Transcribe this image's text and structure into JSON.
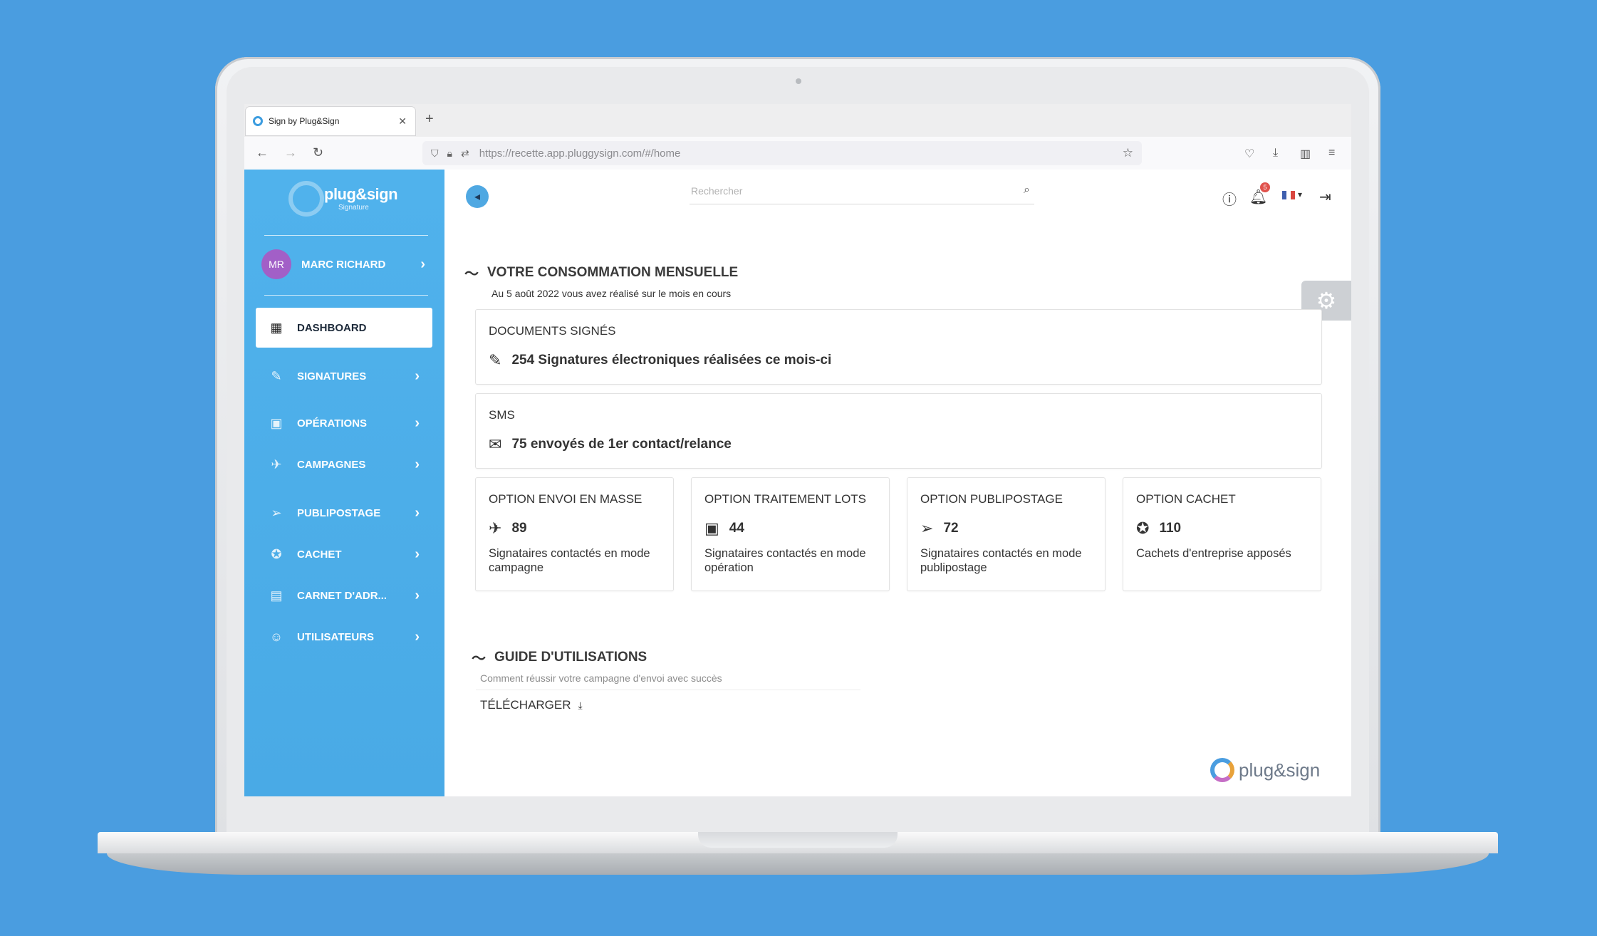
{
  "browser": {
    "tab_title": "Sign by Plug&Sign",
    "url": "https://recette.app.pluggysign.com/#/home"
  },
  "sidebar": {
    "logo_text": "plug&sign",
    "logo_sub": "Signature",
    "user": {
      "initials": "MR",
      "name": "MARC RICHARD"
    },
    "items": [
      {
        "label": "DASHBOARD",
        "icon": "dashboard-icon",
        "active": true
      },
      {
        "label": "SIGNATURES",
        "icon": "signature-icon"
      },
      {
        "label": "OPÉRATIONS",
        "icon": "operations-icon"
      },
      {
        "label": "CAMPAGNES",
        "icon": "campaign-icon"
      },
      {
        "label": "PUBLIPOSTAGE",
        "icon": "send-icon"
      },
      {
        "label": "CACHET",
        "icon": "stamp-icon"
      },
      {
        "label": "CARNET D'ADR...",
        "icon": "address-book-icon"
      },
      {
        "label": "UTILISATEURS",
        "icon": "users-icon"
      }
    ]
  },
  "header": {
    "search_placeholder": "Rechercher",
    "notification_count": "5"
  },
  "consumption": {
    "title": "VOTRE CONSOMMATION MENSUELLE",
    "subtitle": "Au 5 août 2022 vous avez réalisé sur le mois en cours",
    "documents": {
      "title": "DOCUMENTS SIGNÉS",
      "value": "254 Signatures électroniques réalisées ce mois-ci"
    },
    "sms": {
      "title": "SMS",
      "value": "75 envoyés de 1er contact/relance"
    },
    "options": [
      {
        "title": "OPTION ENVOI EN MASSE",
        "value": "89",
        "desc": "Signataires contactés en mode campagne",
        "icon": "campaign-icon"
      },
      {
        "title": "OPTION TRAITEMENT LOTS",
        "value": "44",
        "desc": "Signataires contactés en mode opération",
        "icon": "operations-icon"
      },
      {
        "title": "OPTION PUBLIPOSTAGE",
        "value": "72",
        "desc": "Signataires contactés en mode publipostage",
        "icon": "send-icon"
      },
      {
        "title": "OPTION CACHET",
        "value": "110",
        "desc": "Cachets d'entreprise apposés",
        "icon": "stamp-icon"
      }
    ]
  },
  "guide": {
    "title": "GUIDE D'UTILISATIONS",
    "desc": "Comment réussir votre campagne d'envoi avec succès",
    "download_label": "TÉLÉCHARGER"
  },
  "footer": {
    "brand": "plug&sign"
  },
  "colors": {
    "sidebar": "#4fb0ea",
    "accent": "#4a9de0",
    "badge": "#e0524c"
  }
}
